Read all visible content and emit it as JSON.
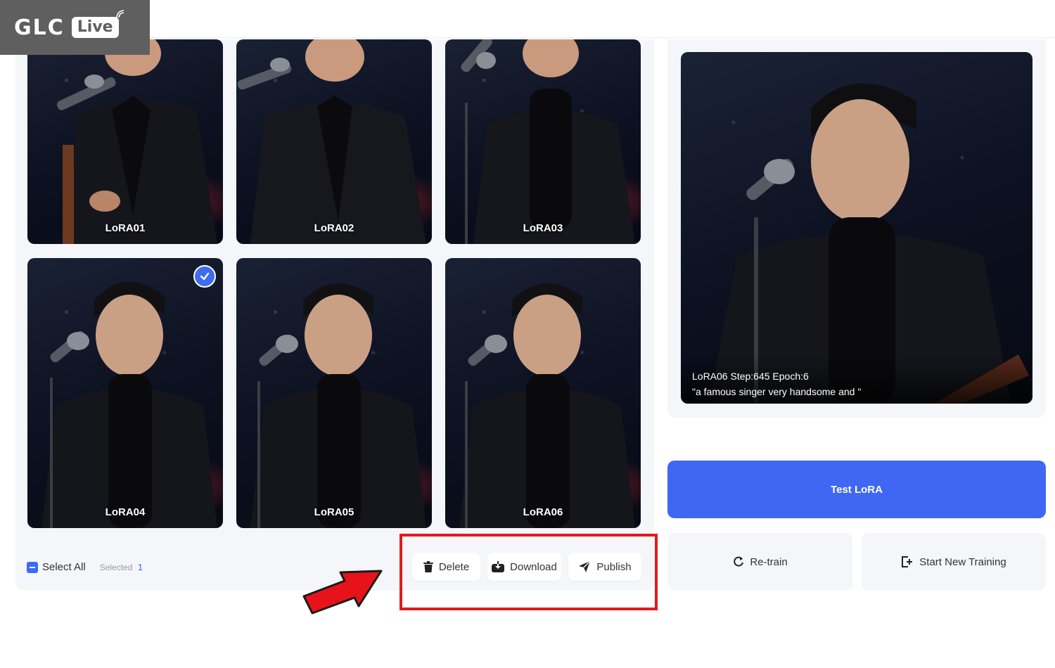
{
  "logo": {
    "brand": "GLC",
    "badge": "Live"
  },
  "gallery": {
    "tiles": [
      {
        "label": "LoRA01",
        "selected": false
      },
      {
        "label": "LoRA02",
        "selected": false
      },
      {
        "label": "LoRA03",
        "selected": false
      },
      {
        "label": "LoRA04",
        "selected": true
      },
      {
        "label": "LoRA05",
        "selected": false
      },
      {
        "label": "LoRA06",
        "selected": false
      }
    ]
  },
  "selection": {
    "select_all_label": "Select All",
    "selected_label": "Selected",
    "selected_count": "1"
  },
  "actions": {
    "delete": "Delete",
    "download": "Download",
    "publish": "Publish"
  },
  "preview": {
    "caption_meta": "LoRA06 Step:645 Epoch:6",
    "caption_prompt": "\"a famous singer very handsome and \""
  },
  "right_actions": {
    "test": "Test LoRA",
    "retrain": "Re-train",
    "new_training": "Start New Training"
  },
  "colors": {
    "accent": "#3f67f3",
    "highlight": "#e11b1b",
    "logo_bg": "#5f5f5f"
  }
}
